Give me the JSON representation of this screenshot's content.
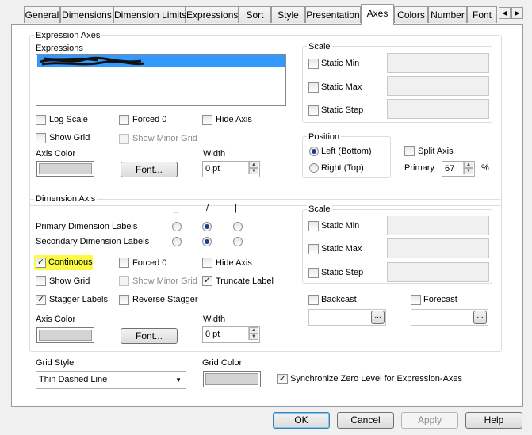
{
  "tabs": [
    "General",
    "Dimensions",
    "Dimension Limits",
    "Expressions",
    "Sort",
    "Style",
    "Presentation",
    "Axes",
    "Colors",
    "Number",
    "Font"
  ],
  "tab_scroll": {
    "left": "◀",
    "right": "▶"
  },
  "expression_axes": {
    "title": "Expression Axes",
    "expressions_label": "Expressions",
    "log_scale": "Log Scale",
    "forced_0": "Forced 0",
    "hide_axis": "Hide Axis",
    "show_grid": "Show Grid",
    "show_minor_grid": "Show Minor Grid",
    "axis_color": "Axis Color",
    "font_button": "Font...",
    "width_label": "Width",
    "width_value": "0 pt",
    "scale": {
      "title": "Scale",
      "static_min": "Static Min",
      "static_max": "Static Max",
      "static_step": "Static Step"
    },
    "position": {
      "title": "Position",
      "left_bottom": "Left (Bottom)",
      "right_top": "Right (Top)"
    },
    "split_axis": "Split Axis",
    "primary_label": "Primary",
    "primary_value": "67",
    "percent": "%"
  },
  "dimension_axis": {
    "title": "Dimension Axis",
    "orientation_headers": [
      "_",
      "/",
      "|"
    ],
    "primary_labels": "Primary Dimension Labels",
    "secondary_labels": "Secondary Dimension Labels",
    "continuous": "Continuous",
    "forced_0": "Forced 0",
    "hide_axis": "Hide Axis",
    "show_grid": "Show Grid",
    "show_minor_grid": "Show Minor Grid",
    "truncate_label": "Truncate Label",
    "stagger_labels": "Stagger Labels",
    "reverse_stagger": "Reverse Stagger",
    "axis_color": "Axis Color",
    "font_button": "Font...",
    "width_label": "Width",
    "width_value": "0 pt",
    "scale": {
      "title": "Scale",
      "static_min": "Static Min",
      "static_max": "Static Max",
      "static_step": "Static Step"
    },
    "backcast": "Backcast",
    "forecast": "Forecast",
    "ellipsis": "..."
  },
  "grid_style": {
    "label": "Grid Style",
    "value": "Thin Dashed Line"
  },
  "grid_color": {
    "label": "Grid Color"
  },
  "sync_zero": "Synchronize Zero Level for Expression-Axes",
  "buttons": {
    "ok": "OK",
    "cancel": "Cancel",
    "apply": "Apply",
    "help": "Help"
  },
  "colors": {
    "highlight": "#fbfb46",
    "selection": "#3399ff",
    "swatch": "#d4d4d4"
  },
  "icons": {
    "check": "✓",
    "dropdown": "▼",
    "spin_up": "▲",
    "spin_down": "▼"
  }
}
